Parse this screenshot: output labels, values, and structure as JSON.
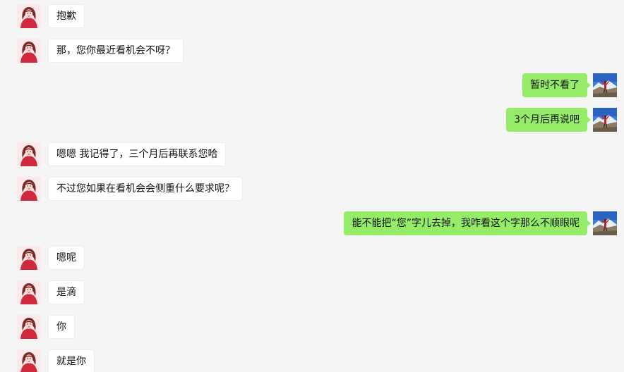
{
  "colors": {
    "background": "#f5f5f5",
    "incoming_bubble": "#ffffff",
    "outgoing_bubble": "#95ec69"
  },
  "avatars": {
    "contact": "woman-red-dress-avatar",
    "self": "mountain-landscape-avatar"
  },
  "messages": [
    {
      "sender": "contact",
      "text": "抱歉"
    },
    {
      "sender": "contact",
      "text": "那，您你最近看机会不呀？"
    },
    {
      "sender": "self",
      "text": "暂时不看了"
    },
    {
      "sender": "self",
      "text": "3个月后再说吧"
    },
    {
      "sender": "contact",
      "text": "嗯嗯  我记得了，三个月后再联系您哈"
    },
    {
      "sender": "contact",
      "text": "不过您如果在看机会会侧重什么要求呢？"
    },
    {
      "sender": "self",
      "text": "能不能把“您”字儿去掉，我咋看这个字那么不顺眼呢"
    },
    {
      "sender": "contact",
      "text": "嗯呢"
    },
    {
      "sender": "contact",
      "text": "是滴"
    },
    {
      "sender": "contact",
      "text": "你"
    },
    {
      "sender": "contact",
      "text": "就是你"
    }
  ]
}
